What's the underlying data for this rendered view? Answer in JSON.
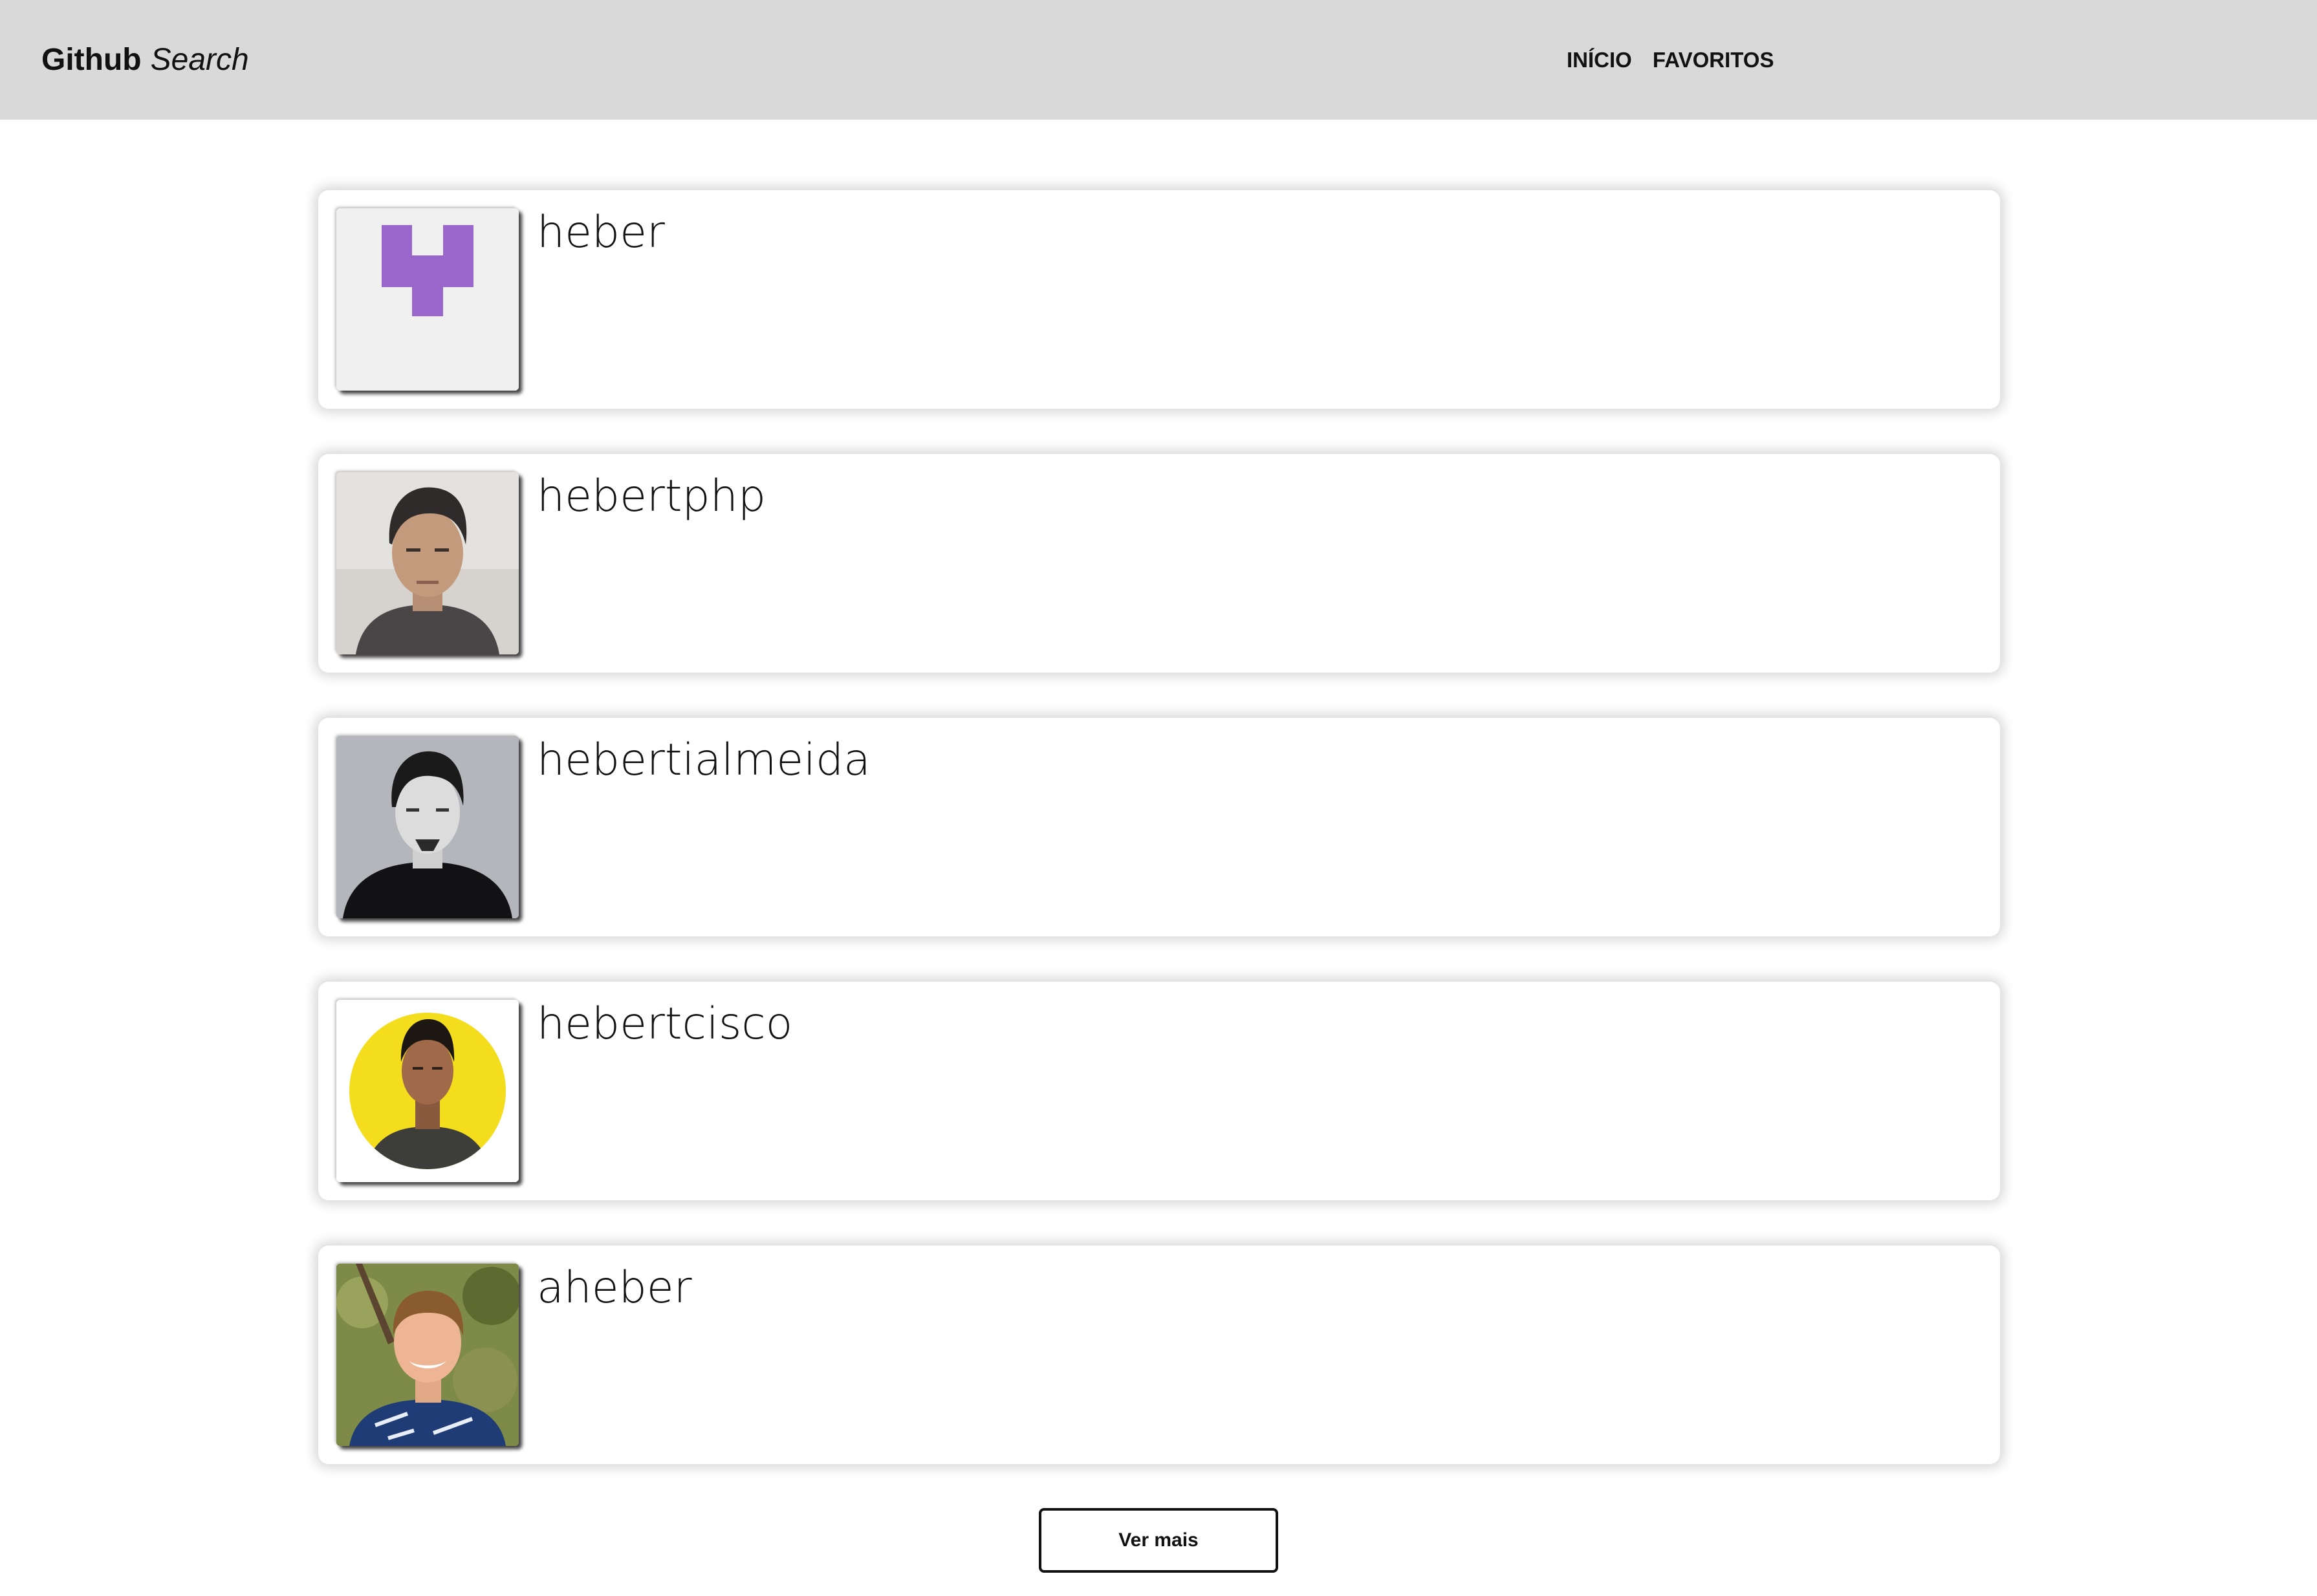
{
  "header": {
    "brand_bold": "Github",
    "brand_italic": "Search",
    "nav": [
      {
        "label": "INÍCIO"
      },
      {
        "label": "FAVORITOS"
      }
    ]
  },
  "users": [
    {
      "login": "heber",
      "avatar": "identicon"
    },
    {
      "login": "hebertphp",
      "avatar": "photo"
    },
    {
      "login": "hebertialmeida",
      "avatar": "photo"
    },
    {
      "login": "hebertcisco",
      "avatar": "photo"
    },
    {
      "login": "aheber",
      "avatar": "photo"
    }
  ],
  "more_button": "Ver mais",
  "colors": {
    "header_bg": "#d9d9d9",
    "identicon": "#9966cc"
  }
}
